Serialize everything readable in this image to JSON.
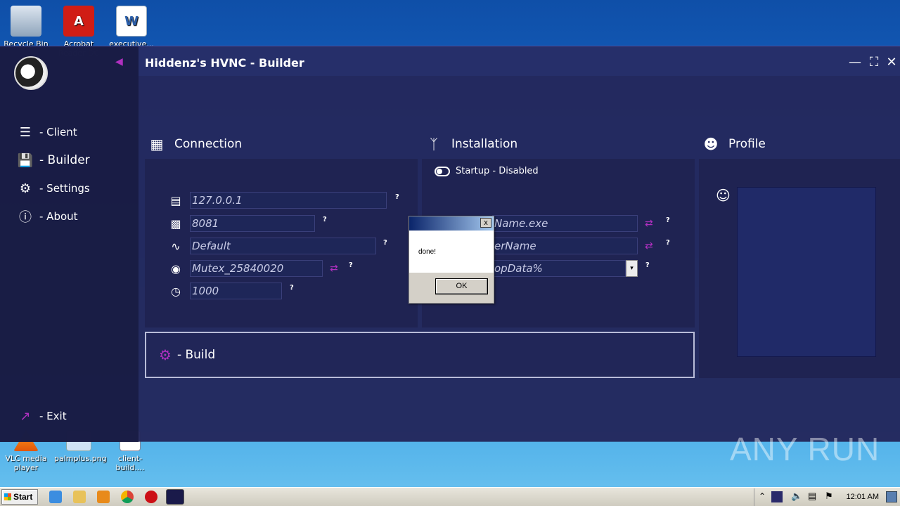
{
  "desktop": {
    "icons": [
      {
        "label": "Recycle Bin"
      },
      {
        "label": "Acrobat Reader DC"
      },
      {
        "label": "executive..."
      },
      {
        "label": "VLC media player"
      },
      {
        "label": "palmplus.png"
      },
      {
        "label": "client-build...."
      }
    ]
  },
  "app": {
    "title": "Hiddenz's HVNC - Builder",
    "nav": [
      {
        "label": "- Client",
        "icon": "list-icon"
      },
      {
        "label": "- Builder",
        "icon": "save-icon"
      },
      {
        "label": "- Settings",
        "icon": "gears-icon"
      },
      {
        "label": "- About",
        "icon": "info-icon"
      }
    ],
    "exit_label": "- Exit",
    "connection": {
      "header": "Connection",
      "ip": "127.0.0.1",
      "port": "8081",
      "tag": "Default",
      "mutex": "Mutex_25840020",
      "delay": "1000"
    },
    "installation": {
      "header": "Installation",
      "startup": "Startup - Disabled",
      "filename": "Name.exe",
      "username": "erName",
      "path": "opData%"
    },
    "profile": {
      "header": "Profile"
    },
    "build_label": "- Build",
    "help_mark": "?"
  },
  "dialog": {
    "message": "done!",
    "ok_label": "OK",
    "close_glyph": "x"
  },
  "taskbar": {
    "start_label": "Start",
    "clock": "12:01 AM"
  },
  "watermark": "ANY RUN",
  "colors": {
    "accent": "#b030c0",
    "window_bg": "#282c64",
    "sidebar_bg": "#181b42"
  }
}
